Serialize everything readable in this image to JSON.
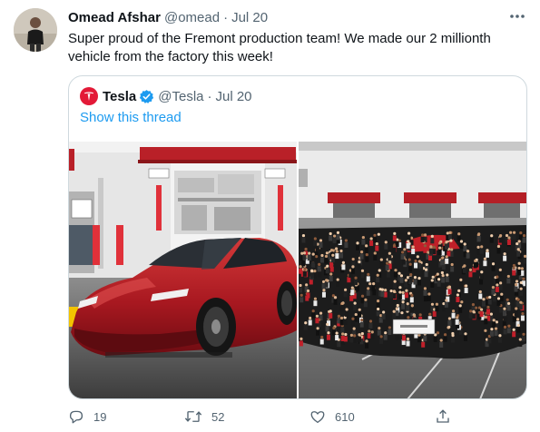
{
  "tweet": {
    "author_name": "Omead Afshar",
    "author_handle": "@omead",
    "separator": "·",
    "date": "Jul 20",
    "text": "Super proud of the Fremont production team! We made our 2 millionth vehicle from the factory this week!"
  },
  "quoted_tweet": {
    "author_name": "Tesla",
    "author_handle": "@Tesla",
    "separator": "·",
    "date": "Jul 20",
    "show_thread_label": "Show this thread"
  },
  "actions": {
    "reply_count": "19",
    "retweet_count": "52",
    "like_count": "610"
  },
  "icons": {
    "more": "more-dots-icon",
    "reply": "reply-icon",
    "retweet": "retweet-icon",
    "like": "heart-icon",
    "share": "share-icon",
    "verified": "verified-badge-icon",
    "tesla_logo": "tesla-logo-icon"
  },
  "colors": {
    "link": "#1d9bf0",
    "secondary_text": "#536471",
    "tesla_red": "#e31937",
    "border": "#cfd9de"
  }
}
